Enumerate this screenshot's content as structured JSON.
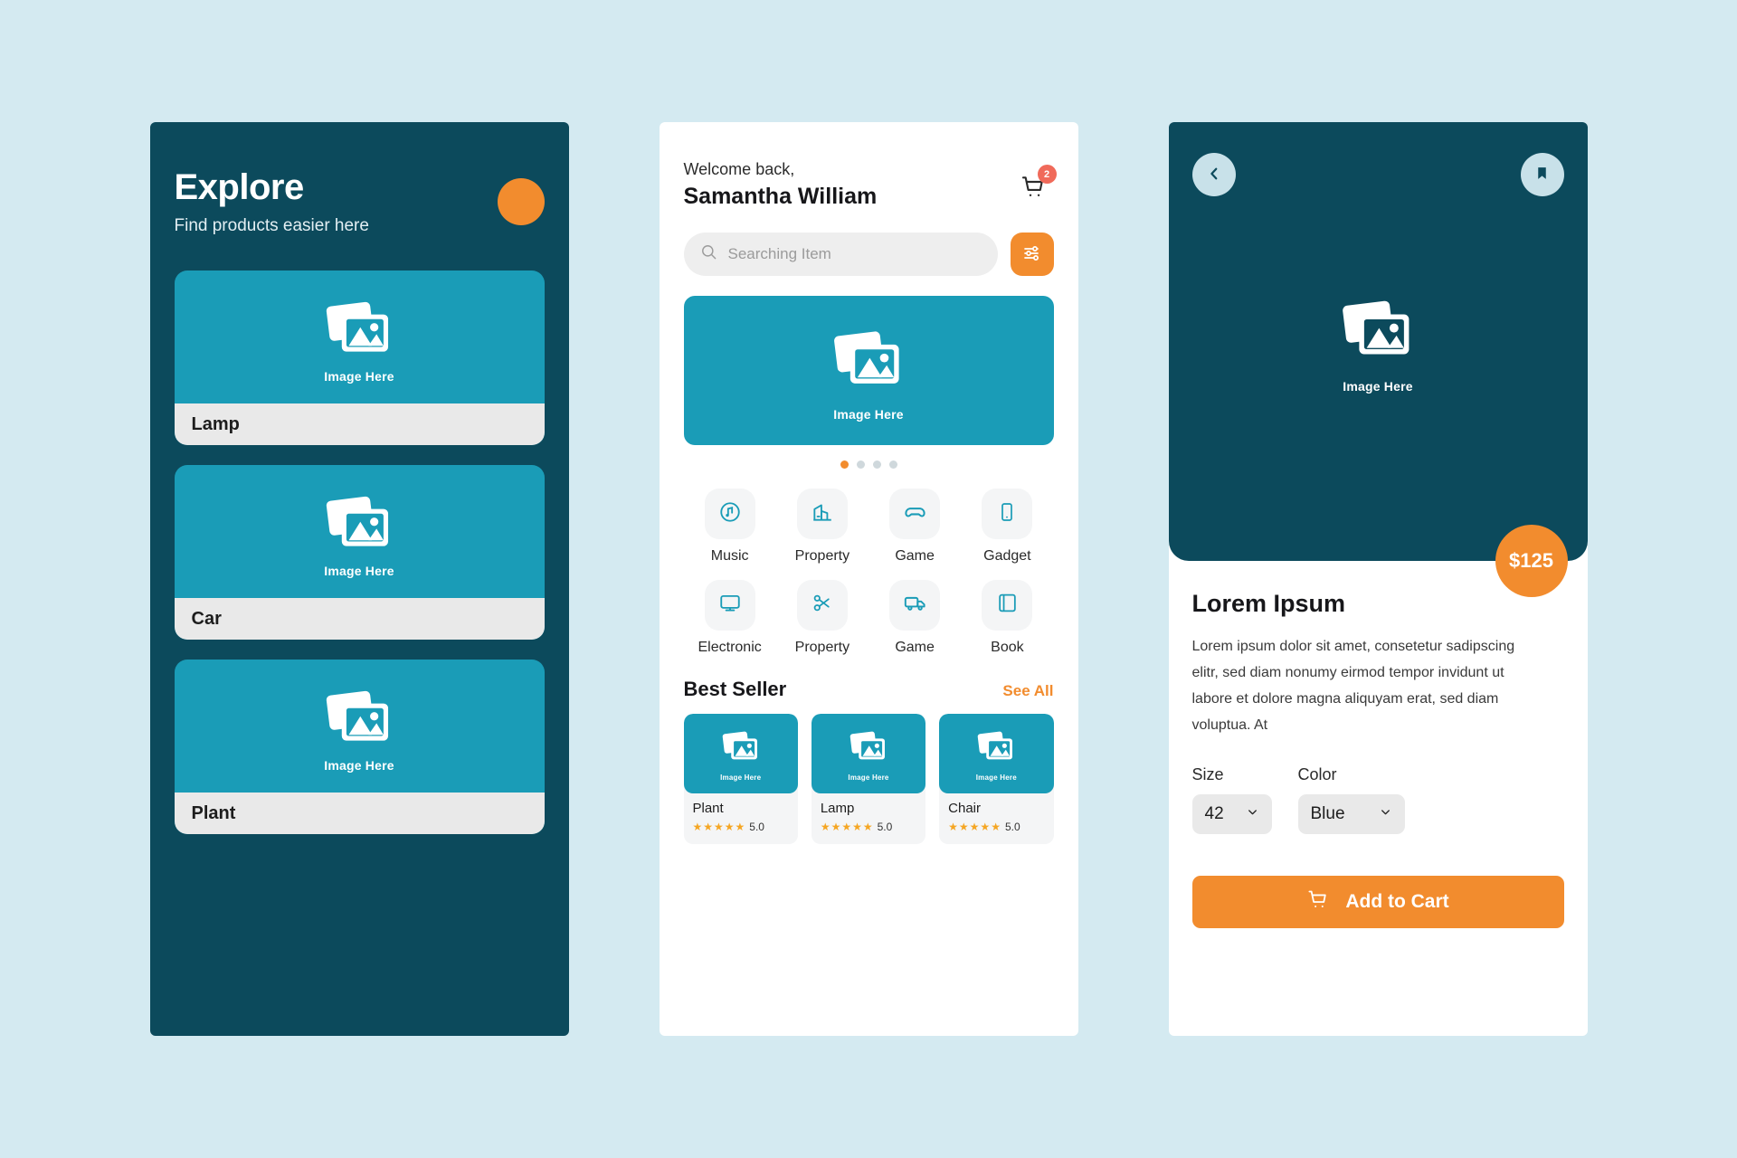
{
  "explore": {
    "title": "Explore",
    "subtitle": "Find products easier here",
    "fab_icon": "circle-button",
    "cards": [
      {
        "label": "Lamp",
        "placeholder": "Image Here",
        "icon": "image-placeholder-icon"
      },
      {
        "label": "Car",
        "placeholder": "Image Here",
        "icon": "image-placeholder-icon"
      },
      {
        "label": "Plant",
        "placeholder": "Image Here",
        "icon": "image-placeholder-icon"
      }
    ]
  },
  "home": {
    "welcome_small": "Welcome back,",
    "welcome_name": "Samantha William",
    "cart_icon": "shopping-cart-icon",
    "cart_count": "2",
    "search": {
      "placeholder": "Searching Item",
      "value": "",
      "icon": "search-icon",
      "filter_icon": "filter-sliders-icon"
    },
    "hero": {
      "placeholder": "Image Here",
      "icon": "image-placeholder-icon"
    },
    "carousel": {
      "total": 4,
      "active_index": 0
    },
    "categories": [
      {
        "label": "Music",
        "icon": "music-disc-icon"
      },
      {
        "label": "Property",
        "icon": "building-icon"
      },
      {
        "label": "Game",
        "icon": "gamepad-icon"
      },
      {
        "label": "Gadget",
        "icon": "smartphone-icon"
      },
      {
        "label": "Electronic",
        "icon": "monitor-icon"
      },
      {
        "label": "Property",
        "icon": "scissors-icon"
      },
      {
        "label": "Game",
        "icon": "truck-icon"
      },
      {
        "label": "Book",
        "icon": "book-icon"
      }
    ],
    "best_seller": {
      "title": "Best Seller",
      "see_all": "See All",
      "products": [
        {
          "name": "Plant",
          "rating": "5.0",
          "stars": "★★★★★",
          "placeholder": "Image Here"
        },
        {
          "name": "Lamp",
          "rating": "5.0",
          "stars": "★★★★★",
          "placeholder": "Image Here"
        },
        {
          "name": "Chair",
          "rating": "5.0",
          "stars": "★★★★★",
          "placeholder": "Image Here"
        }
      ]
    }
  },
  "detail": {
    "back_icon": "chevron-left-icon",
    "bookmark_icon": "bookmark-icon",
    "hero": {
      "placeholder": "Image Here",
      "icon": "image-placeholder-icon"
    },
    "price": "$125",
    "title": "Lorem Ipsum",
    "description": "Lorem ipsum dolor sit amet, consetetur sadipscing elitr, sed diam nonumy eirmod tempor invidunt ut labore et dolore magna aliquyam erat, sed diam voluptua. At",
    "size": {
      "label": "Size",
      "value": "42",
      "chevron": "chevron-down-icon"
    },
    "color": {
      "label": "Color",
      "value": "Blue",
      "chevron": "chevron-down-icon"
    },
    "add_to_cart": {
      "label": "Add to Cart",
      "icon": "cart-icon"
    }
  },
  "colors": {
    "background": "#d4eaf1",
    "dark_teal": "#0c4a5c",
    "teal": "#1a9cb7",
    "orange": "#f28c2e",
    "badge_red": "#f06a5a",
    "star": "#f5a623"
  }
}
